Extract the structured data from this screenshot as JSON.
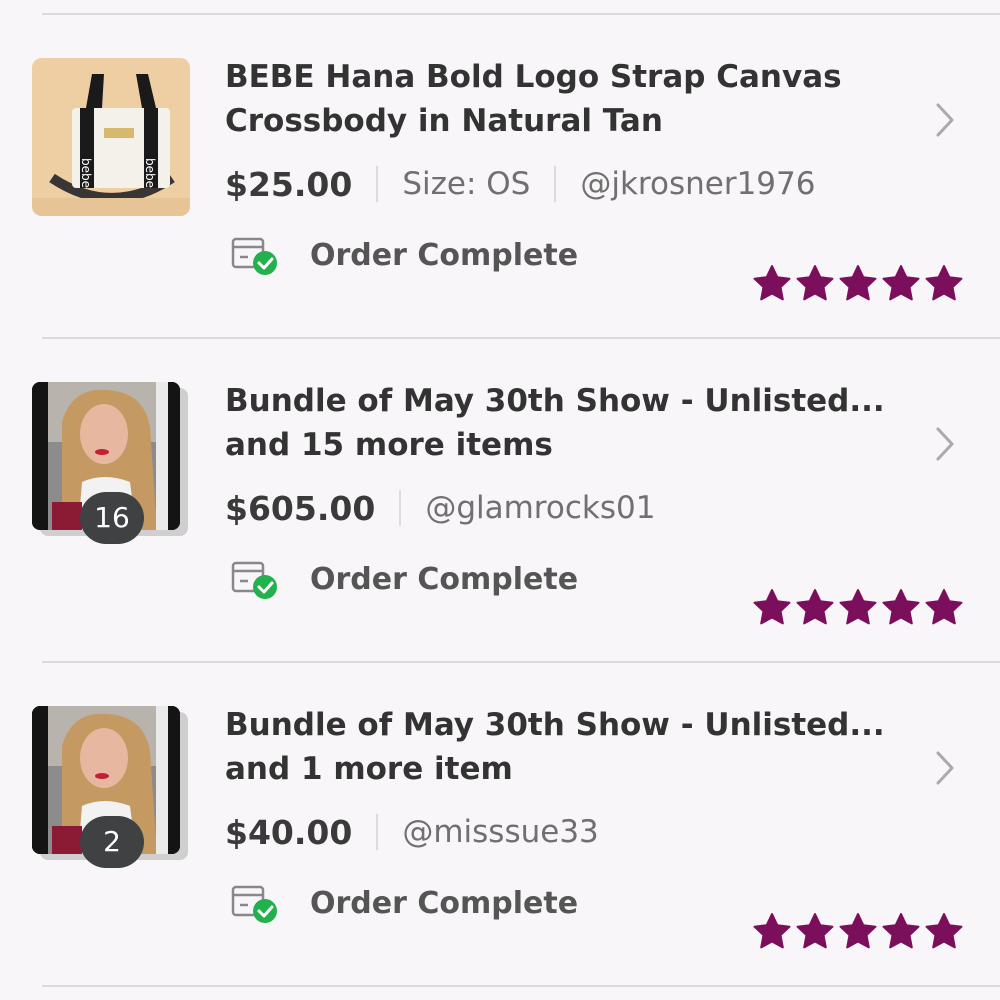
{
  "orders": [
    {
      "title": "BEBE Hana Bold Logo Strap Canvas Crossbody in Natural Tan",
      "price": "$25.00",
      "size": "Size: OS",
      "seller": "@jkrosner1976",
      "status": "Order Complete",
      "rating": 5,
      "thumbnail": "bag-photo",
      "bag_print": "bebe"
    },
    {
      "title": "Bundle of May 30th Show - Unlisted... and 15 more items",
      "price": "$605.00",
      "seller": "@glamrocks01",
      "count": "16",
      "status": "Order Complete",
      "rating": 5,
      "thumbnail": "portrait-photo"
    },
    {
      "title": "Bundle of May 30th Show - Unlisted... and 1 more item",
      "price": "$40.00",
      "seller": "@misssue33",
      "count": "2",
      "status": "Order Complete",
      "rating": 5,
      "thumbnail": "portrait-photo"
    }
  ],
  "icons": {
    "status": "package-check-icon",
    "chevron": "chevron-right-icon",
    "star": "star-icon"
  },
  "colors": {
    "star": "#7b0f5c",
    "check": "#22b14c",
    "background": "#f8f6f8",
    "divider": "#dcd9dc"
  }
}
